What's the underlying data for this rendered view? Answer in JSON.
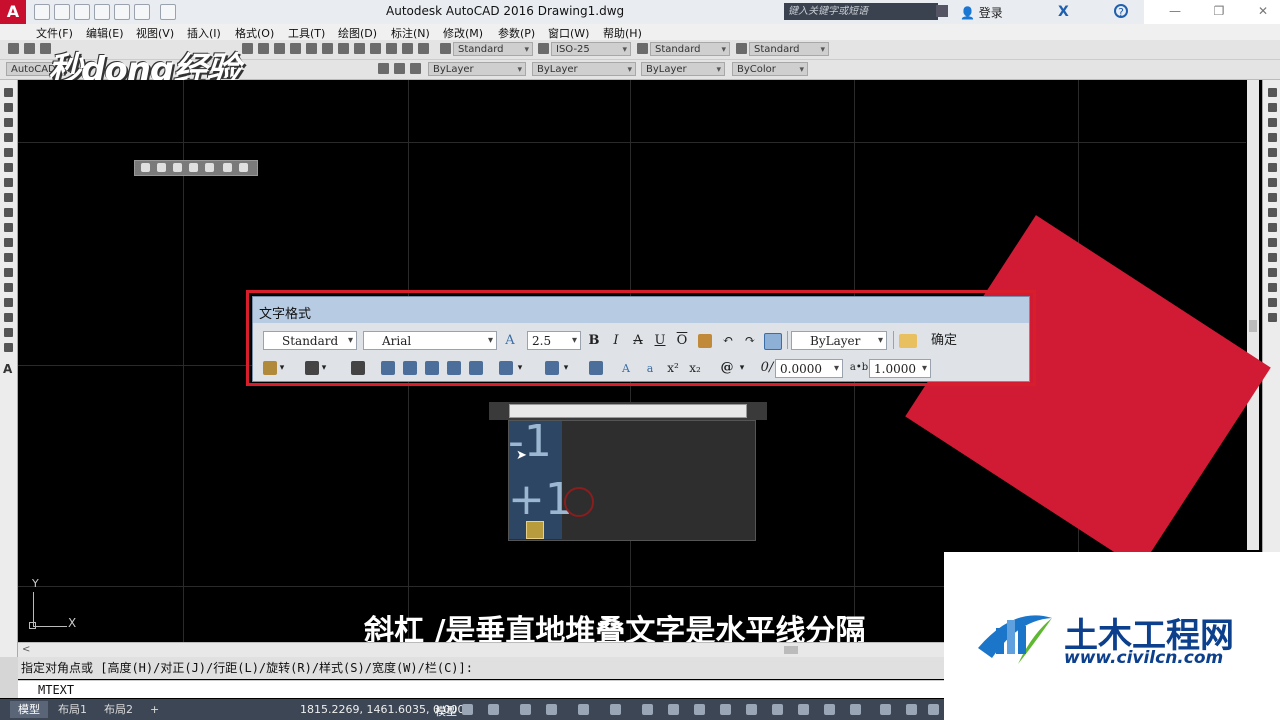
{
  "window": {
    "title": "Autodesk AutoCAD 2016   Drawing1.dwg",
    "search_placeholder": "键入关键字或短语",
    "login": "登录"
  },
  "menubar": [
    "文件(F)",
    "编辑(E)",
    "视图(V)",
    "插入(I)",
    "格式(O)",
    "工具(T)",
    "绘图(D)",
    "标注(N)",
    "修改(M)",
    "参数(P)",
    "窗口(W)",
    "帮助(H)"
  ],
  "toolbar1": {
    "text_style": "Standard",
    "dim_style": "ISO-25",
    "table_style": "Standard",
    "multileader_style": "Standard"
  },
  "toolbar2": {
    "workspace": "AutoCAD",
    "color": "ByLayer",
    "linetype": "ByLayer",
    "lineweight": "ByLayer",
    "plotstyle": "ByColor"
  },
  "watermark": "秒dong经验",
  "text_format": {
    "title": "文字格式",
    "style": "Standard",
    "font": "Arial",
    "height": "2.5",
    "bold": "B",
    "italic": "I",
    "strike": "A",
    "underline": "U",
    "overline": "O",
    "color": "ByLayer",
    "ok": "确定",
    "oblique": "0.0000",
    "tracking": "1.0000"
  },
  "editor": {
    "line1": "-1",
    "line2": "+1"
  },
  "caption": "斜杠 /是垂直地堆叠文字是水平线分隔",
  "ucs": {
    "x": "X",
    "y": "Y"
  },
  "logo": {
    "name": "土木工程网",
    "url": "www.civilcn.com"
  },
  "command": {
    "prompt": "指定对角点或 [高度(H)/对正(J)/行距(L)/旋转(R)/样式(S)/宽度(W)/栏(C)]:",
    "current": "MTEXT"
  },
  "statusbar": {
    "tabs": [
      "模型",
      "布局1",
      "布局2"
    ],
    "add": "+",
    "coords": "1815.2269, 1461.6035, 0.0000",
    "space": "模型"
  },
  "colors": {
    "accent_red": "#d11b35",
    "logo_blue": "#0c3f8c"
  }
}
